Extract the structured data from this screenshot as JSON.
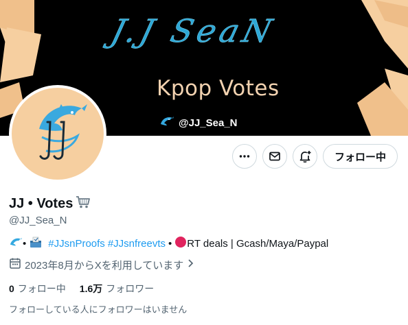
{
  "banner": {
    "script_title": "J.J SeaN",
    "subtitle": "Kpop Votes",
    "handle": "@JJ_Sea_N",
    "background": "#000000",
    "deco_color": "#f6cfa0"
  },
  "avatar": {
    "monogram": "JJ",
    "background": "#f6cfa0",
    "icon": "dolphin-icon"
  },
  "actions": {
    "more_icon": "more-icon",
    "message_icon": "mail-icon",
    "notify_icon": "bell-plus-icon",
    "follow_label": "フォロー中"
  },
  "profile": {
    "display_name": "JJ • Votes",
    "name_emoji": "🛒",
    "username": "@JJ_Sea_N",
    "bio": {
      "bullet1": "•",
      "hashtag1": "#JJsnProofs",
      "hashtag2": "#JJsnfreevts",
      "bullet2": "•",
      "deals_text": "RT deals | Gcash/Maya/Paypal"
    },
    "joined": "2023年8月からXを利用しています",
    "following_count": "0",
    "following_label": "フォロー中",
    "followers_count": "1.6万",
    "followers_label": "フォロワー",
    "no_followers_note": "フォローしている人にフォロワーはいません"
  },
  "colors": {
    "link": "#1d9bf0",
    "secondary_text": "#536471",
    "primary_text": "#0f1419",
    "border": "#cfd9de",
    "red_dot": "#e0245e"
  }
}
